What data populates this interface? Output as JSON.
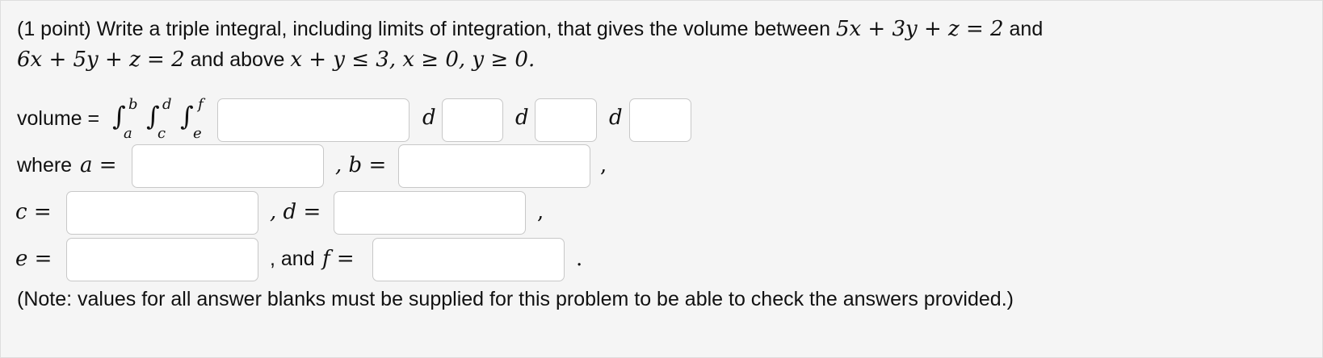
{
  "problem": {
    "prefix": "(1 point) Write a triple integral, including limits of integration, that gives the volume between",
    "plane1": "5x + 3y + z = 2",
    "and1": "and",
    "plane2": "6x + 5y + z = 2",
    "and2": "and above",
    "region": "x + y ≤ 3, x ≥ 0, y ≥ 0."
  },
  "volume_row": {
    "label": "volume =",
    "integral_symbol": "∫",
    "upper_limits": [
      "b",
      "d",
      "f"
    ],
    "lower_limits": [
      "a",
      "c",
      "e"
    ],
    "differential": "d"
  },
  "limits": {
    "where": "where",
    "a_var": "a =",
    "sep_b": ", b =",
    "trail_ab": ",",
    "c_var": "c =",
    "sep_d": ", d =",
    "trail_cd": ",",
    "e_var": "e =",
    "and_text": ", and",
    "f_var": "f =",
    "period": "."
  },
  "fields": {
    "integrand": "",
    "d1": "",
    "d2": "",
    "d3": "",
    "a": "",
    "b": "",
    "c": "",
    "d": "",
    "e": "",
    "f": ""
  },
  "note": "(Note: values for all answer blanks must be supplied for this problem to be able to check the answers provided.)",
  "colors": {
    "panel_bg": "#f5f5f5",
    "input_border": "#c8c8c8",
    "text": "#111111"
  }
}
